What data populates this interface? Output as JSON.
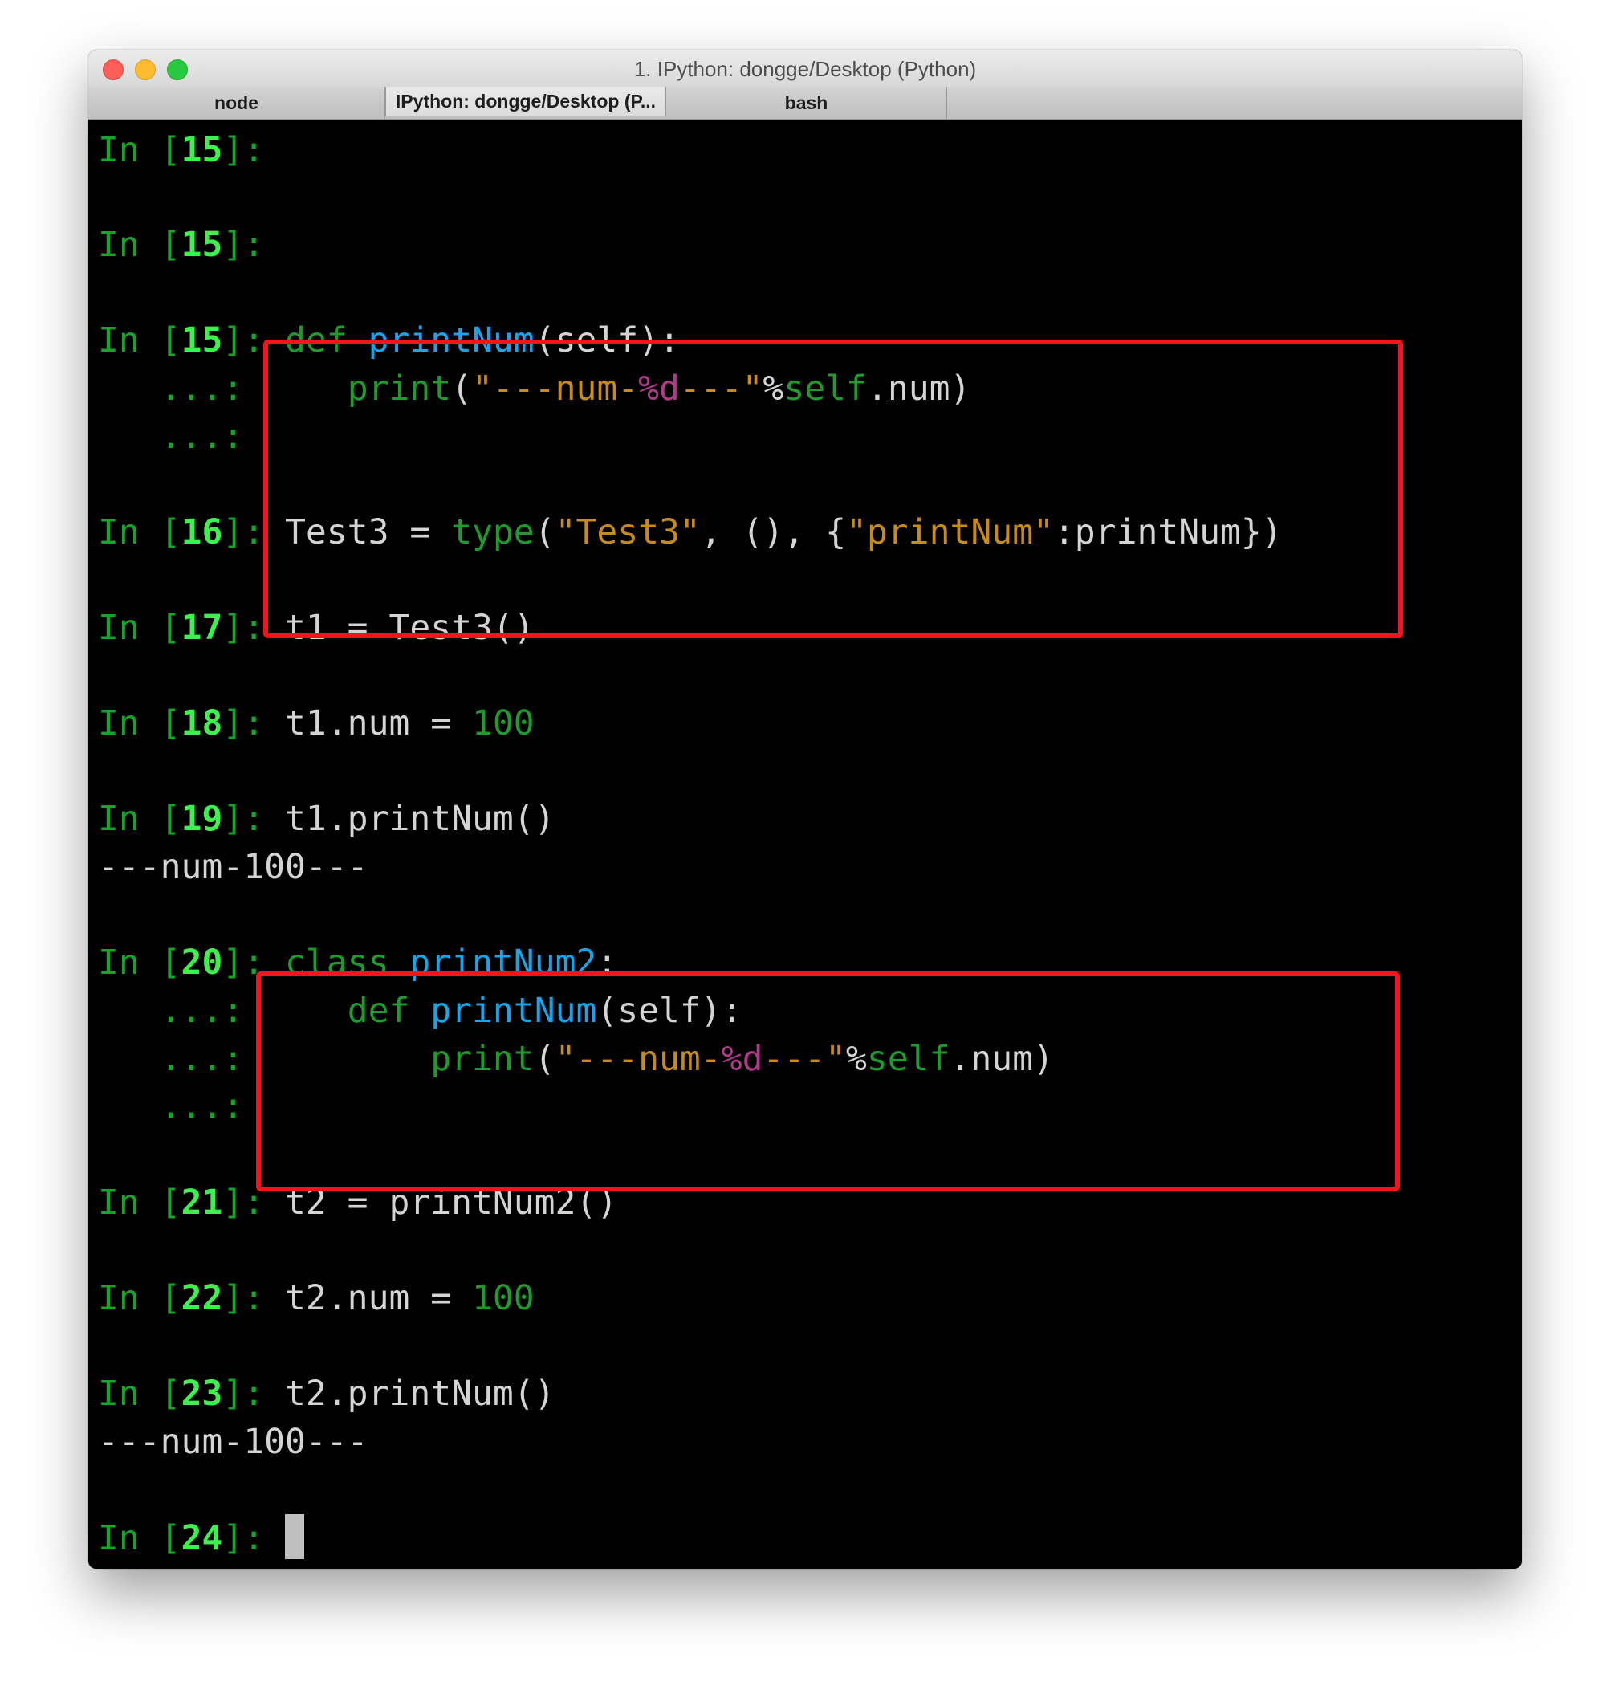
{
  "window": {
    "title": "1. IPython: dongge/Desktop (Python)"
  },
  "tabs": [
    {
      "label": "node"
    },
    {
      "label": "IPython: dongge/Desktop (P..."
    },
    {
      "label": "bash"
    }
  ],
  "prompt": {
    "in_text": "In [",
    "close_text": "]: ",
    "continuation": "...: "
  },
  "lines": {
    "l1": {
      "num": "15"
    },
    "l2": {
      "num": "15"
    },
    "l3": {
      "num": "15",
      "kw": "def",
      "fn": "printNum",
      "rest": "(self):"
    },
    "l4": {
      "indent": "    ",
      "print": "print",
      "open": "(",
      "str1": "\"---num-",
      "fmt": "%d",
      "str2": "---\"",
      "pct": "%",
      "self": "self",
      "tail": ".num)"
    },
    "l5": {},
    "l6": {
      "num": "16",
      "a": "Test3 = ",
      "type": "type",
      "b": "(",
      "s1": "\"Test3\"",
      "c": ", (), {",
      "s2": "\"printNum\"",
      "d": ":printNum})"
    },
    "l7": {
      "num": "17",
      "code": "t1 = Test3()"
    },
    "l8": {
      "num": "18",
      "code": "t1.num = ",
      "val": "100"
    },
    "l9": {
      "num": "19",
      "code": "t1.printNum()"
    },
    "l9o": {
      "output": "---num-100---"
    },
    "l10": {
      "num": "20",
      "kw": "class",
      "fn": "printNum2",
      "rest": ":"
    },
    "l11": {
      "indent": "    ",
      "kw": "def",
      "fn": "printNum",
      "rest": "(self):"
    },
    "l12": {
      "indent": "        ",
      "print": "print",
      "open": "(",
      "str1": "\"---num-",
      "fmt": "%d",
      "str2": "---\"",
      "pct": "%",
      "self": "self",
      "tail": ".num)"
    },
    "l13": {},
    "l14": {
      "num": "21",
      "code": "t2 = printNum2()"
    },
    "l15": {
      "num": "22",
      "code": "t2.num = ",
      "val": "100"
    },
    "l16": {
      "num": "23",
      "code": "t2.printNum()"
    },
    "l16o": {
      "output": "---num-100---"
    },
    "l17": {
      "num": "24"
    }
  },
  "colors": {
    "highlight": "#f5141c",
    "prompt_green": "#18a32a",
    "prompt_number": "#3cf04d",
    "keyword": "#1e9b2c",
    "function": "#1aa3e6",
    "string": "#c78a1c",
    "format_spec": "#b0398c"
  }
}
